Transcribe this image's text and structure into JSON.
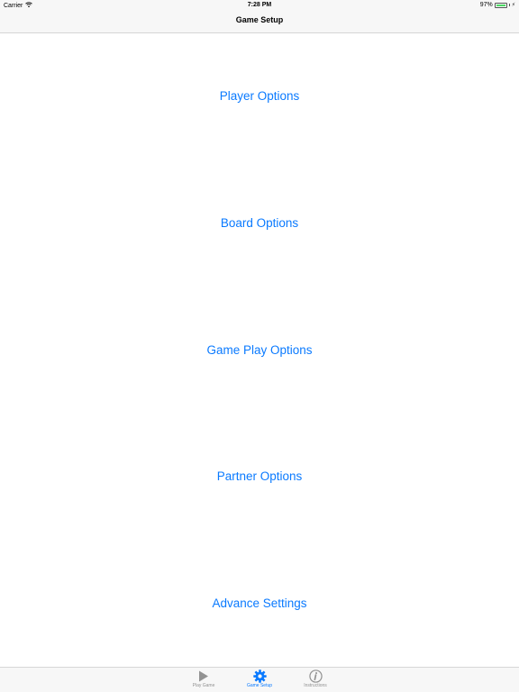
{
  "status_bar": {
    "carrier": "Carrier",
    "time": "7:28 PM",
    "battery_percent": "97%",
    "battery_level": 0.97,
    "icons": [
      "wifi-icon",
      "battery-icon",
      "charging-bolt-icon"
    ]
  },
  "nav": {
    "title": "Game Setup"
  },
  "options": [
    {
      "label": "Player Options"
    },
    {
      "label": "Board Options"
    },
    {
      "label": "Game Play Options"
    },
    {
      "label": "Partner Options"
    },
    {
      "label": "Advance Settings"
    }
  ],
  "tabs": [
    {
      "label": "Play Game",
      "icon": "play-icon",
      "active": false
    },
    {
      "label": "Game Setup",
      "icon": "gear-icon",
      "active": true
    },
    {
      "label": "Instructions",
      "icon": "info-icon",
      "active": false
    }
  ],
  "colors": {
    "accent": "#0a7aff",
    "inactive": "#929292",
    "battery": "#4cd964",
    "bar_bg": "#f7f7f7"
  }
}
